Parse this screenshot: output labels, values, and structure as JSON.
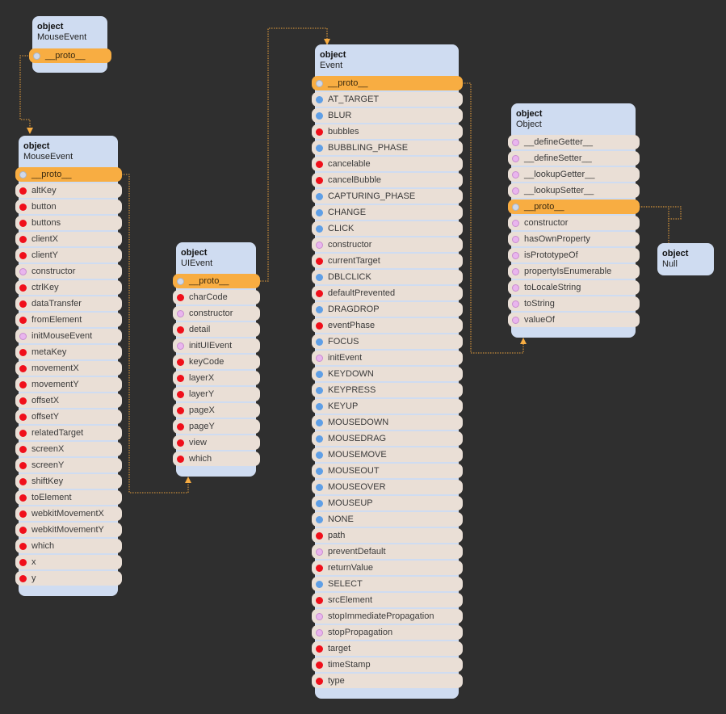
{
  "nodes": [
    {
      "id": "mouseevent-instance",
      "kind": "object",
      "name": "MouseEvent",
      "rows": [
        {
          "label": "__proto__",
          "type": "proto"
        }
      ]
    },
    {
      "id": "mouseevent-prototype",
      "kind": "object",
      "name": "MouseEvent",
      "rows": [
        {
          "label": "__proto__",
          "type": "proto"
        },
        {
          "label": "altKey",
          "type": "field"
        },
        {
          "label": "button",
          "type": "field"
        },
        {
          "label": "buttons",
          "type": "field"
        },
        {
          "label": "clientX",
          "type": "field"
        },
        {
          "label": "clientY",
          "type": "field"
        },
        {
          "label": "constructor",
          "type": "method"
        },
        {
          "label": "ctrlKey",
          "type": "field"
        },
        {
          "label": "dataTransfer",
          "type": "field"
        },
        {
          "label": "fromElement",
          "type": "field"
        },
        {
          "label": "initMouseEvent",
          "type": "method"
        },
        {
          "label": "metaKey",
          "type": "field"
        },
        {
          "label": "movementX",
          "type": "field"
        },
        {
          "label": "movementY",
          "type": "field"
        },
        {
          "label": "offsetX",
          "type": "field"
        },
        {
          "label": "offsetY",
          "type": "field"
        },
        {
          "label": "relatedTarget",
          "type": "field"
        },
        {
          "label": "screenX",
          "type": "field"
        },
        {
          "label": "screenY",
          "type": "field"
        },
        {
          "label": "shiftKey",
          "type": "field"
        },
        {
          "label": "toElement",
          "type": "field"
        },
        {
          "label": "webkitMovementX",
          "type": "field"
        },
        {
          "label": "webkitMovementY",
          "type": "field"
        },
        {
          "label": "which",
          "type": "field"
        },
        {
          "label": "x",
          "type": "field"
        },
        {
          "label": "y",
          "type": "field"
        }
      ]
    },
    {
      "id": "uievent-prototype",
      "kind": "object",
      "name": "UIEvent",
      "rows": [
        {
          "label": "__proto__",
          "type": "proto"
        },
        {
          "label": "charCode",
          "type": "field"
        },
        {
          "label": "constructor",
          "type": "method"
        },
        {
          "label": "detail",
          "type": "field"
        },
        {
          "label": "initUIEvent",
          "type": "method"
        },
        {
          "label": "keyCode",
          "type": "field"
        },
        {
          "label": "layerX",
          "type": "field"
        },
        {
          "label": "layerY",
          "type": "field"
        },
        {
          "label": "pageX",
          "type": "field"
        },
        {
          "label": "pageY",
          "type": "field"
        },
        {
          "label": "view",
          "type": "field"
        },
        {
          "label": "which",
          "type": "field"
        }
      ]
    },
    {
      "id": "event-prototype",
      "kind": "object",
      "name": "Event",
      "rows": [
        {
          "label": "__proto__",
          "type": "proto"
        },
        {
          "label": "AT_TARGET",
          "type": "const"
        },
        {
          "label": "BLUR",
          "type": "const"
        },
        {
          "label": "bubbles",
          "type": "field"
        },
        {
          "label": "BUBBLING_PHASE",
          "type": "const"
        },
        {
          "label": "cancelable",
          "type": "field"
        },
        {
          "label": "cancelBubble",
          "type": "field"
        },
        {
          "label": "CAPTURING_PHASE",
          "type": "const"
        },
        {
          "label": "CHANGE",
          "type": "const"
        },
        {
          "label": "CLICK",
          "type": "const"
        },
        {
          "label": "constructor",
          "type": "method"
        },
        {
          "label": "currentTarget",
          "type": "field"
        },
        {
          "label": "DBLCLICK",
          "type": "const"
        },
        {
          "label": "defaultPrevented",
          "type": "field"
        },
        {
          "label": "DRAGDROP",
          "type": "const"
        },
        {
          "label": "eventPhase",
          "type": "field"
        },
        {
          "label": "FOCUS",
          "type": "const"
        },
        {
          "label": "initEvent",
          "type": "method"
        },
        {
          "label": "KEYDOWN",
          "type": "const"
        },
        {
          "label": "KEYPRESS",
          "type": "const"
        },
        {
          "label": "KEYUP",
          "type": "const"
        },
        {
          "label": "MOUSEDOWN",
          "type": "const"
        },
        {
          "label": "MOUSEDRAG",
          "type": "const"
        },
        {
          "label": "MOUSEMOVE",
          "type": "const"
        },
        {
          "label": "MOUSEOUT",
          "type": "const"
        },
        {
          "label": "MOUSEOVER",
          "type": "const"
        },
        {
          "label": "MOUSEUP",
          "type": "const"
        },
        {
          "label": "NONE",
          "type": "const"
        },
        {
          "label": "path",
          "type": "field"
        },
        {
          "label": "preventDefault",
          "type": "method"
        },
        {
          "label": "returnValue",
          "type": "field"
        },
        {
          "label": "SELECT",
          "type": "const"
        },
        {
          "label": "srcElement",
          "type": "field"
        },
        {
          "label": "stopImmediatePropagation",
          "type": "method"
        },
        {
          "label": "stopPropagation",
          "type": "method"
        },
        {
          "label": "target",
          "type": "field"
        },
        {
          "label": "timeStamp",
          "type": "field"
        },
        {
          "label": "type",
          "type": "field"
        }
      ]
    },
    {
      "id": "object-prototype",
      "kind": "object",
      "name": "Object",
      "rows": [
        {
          "label": "__defineGetter__",
          "type": "method"
        },
        {
          "label": "__defineSetter__",
          "type": "method"
        },
        {
          "label": "__lookupGetter__",
          "type": "method"
        },
        {
          "label": "__lookupSetter__",
          "type": "method"
        },
        {
          "label": "__proto__",
          "type": "proto"
        },
        {
          "label": "constructor",
          "type": "method"
        },
        {
          "label": "hasOwnProperty",
          "type": "method"
        },
        {
          "label": "isPrototypeOf",
          "type": "method"
        },
        {
          "label": "propertyIsEnumerable",
          "type": "method"
        },
        {
          "label": "toLocaleString",
          "type": "method"
        },
        {
          "label": "toString",
          "type": "method"
        },
        {
          "label": "valueOf",
          "type": "method"
        }
      ]
    },
    {
      "id": "null-object",
      "kind": "object",
      "name": "Null",
      "rows": []
    }
  ],
  "links": [
    {
      "from": "mouseevent-instance",
      "to": "mouseevent-prototype",
      "via": "__proto__"
    },
    {
      "from": "mouseevent-prototype",
      "to": "uievent-prototype",
      "via": "__proto__"
    },
    {
      "from": "uievent-prototype",
      "to": "event-prototype",
      "via": "__proto__"
    },
    {
      "from": "event-prototype",
      "to": "object-prototype",
      "via": "__proto__"
    },
    {
      "from": "object-prototype",
      "to": "null-object",
      "via": "__proto__"
    }
  ],
  "colors": {
    "background": "#2f2f2f",
    "node": "#cfdcf1",
    "row": "#eadfd6",
    "proto_row": "#f8ad42",
    "link": "#e3a440",
    "field_dot": "#f00f1a",
    "method_dot": "#e9b5ee",
    "const_dot": "#5f9fe6",
    "proto_dot": "#cfd8ea"
  }
}
